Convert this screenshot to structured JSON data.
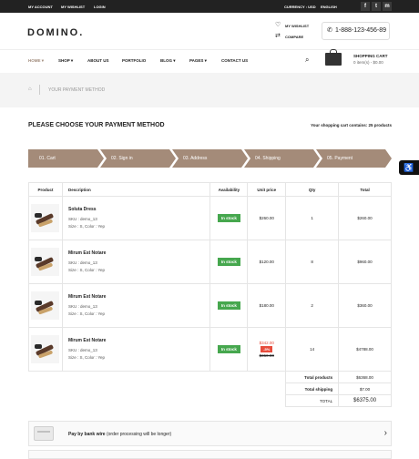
{
  "topbar": {
    "links": [
      "MY ACCOUNT",
      "MY WISHLIST",
      "LOGIN"
    ],
    "currency": "CURRENCY : USD",
    "language": "ENGLISH",
    "social": [
      "f",
      "t",
      "m"
    ]
  },
  "header": {
    "logo": "DOMINO.",
    "wishlist": "MY WISHLIST",
    "compare": "COMPARE",
    "phone": "1-888-123-456-89",
    "cart_title": "SHOPPING CART",
    "cart_info": "0 item(s) - $0.00"
  },
  "nav": [
    {
      "label": "HOME"
    },
    {
      "label": "SHOP"
    },
    {
      "label": "ABOUT US"
    },
    {
      "label": "PORTFOLIO"
    },
    {
      "label": "BLOG"
    },
    {
      "label": "PAGES"
    },
    {
      "label": "CONTACT US"
    }
  ],
  "breadcrumb": {
    "current": "YOUR PAYMENT METHOD"
  },
  "page": {
    "title": "PLEASE CHOOSE YOUR PAYMENT METHOD",
    "cart_count": "Your shopping cart contains: 25 products"
  },
  "steps": [
    "01. Cart",
    "02. Sign in",
    "03. Address",
    "04. Shipping",
    "05. Payment"
  ],
  "table": {
    "headers": [
      "Product",
      "Description",
      "Availability",
      "Unit price",
      "Qty",
      "Total"
    ],
    "rows": [
      {
        "name": "Soluta Dress",
        "sku": "SKU : demo_13",
        "attrs": "Size : S, Color : Yep",
        "stock": "In stock",
        "price": "$260.00",
        "qty": "1",
        "total": "$260.00"
      },
      {
        "name": "Mirum Est Notare",
        "sku": "SKU : demo_13",
        "attrs": "Size : S, Color : Yep",
        "stock": "In stock",
        "price": "$120.00",
        "qty": "8",
        "total": "$960.00"
      },
      {
        "name": "Mirum Est Notare",
        "sku": "SKU : demo_13",
        "attrs": "Size : S, Color : Yep",
        "stock": "In stock",
        "price": "$180.00",
        "qty": "2",
        "total": "$360.00"
      },
      {
        "name": "Mirum Est Notare",
        "sku": "SKU : demo_13",
        "attrs": "Size : S, Color : Yep",
        "stock": "In stock",
        "price": "$342.00",
        "discount": "-5%",
        "old_price": "$360.00",
        "qty": "14",
        "total": "$4788.00"
      }
    ],
    "totals": [
      {
        "label": "Total products",
        "value": "$6368.00"
      },
      {
        "label": "Total shipping",
        "value": "$7.00"
      },
      {
        "label": "TOTAL",
        "value": "$6375.00"
      }
    ]
  },
  "payment": {
    "option_bold": "Pay by bank wire",
    "option_note": " (order processing will be longer)"
  },
  "colors": {
    "accent": "#a48b79",
    "stock": "#46a74e",
    "sale": "#e74c3c"
  }
}
